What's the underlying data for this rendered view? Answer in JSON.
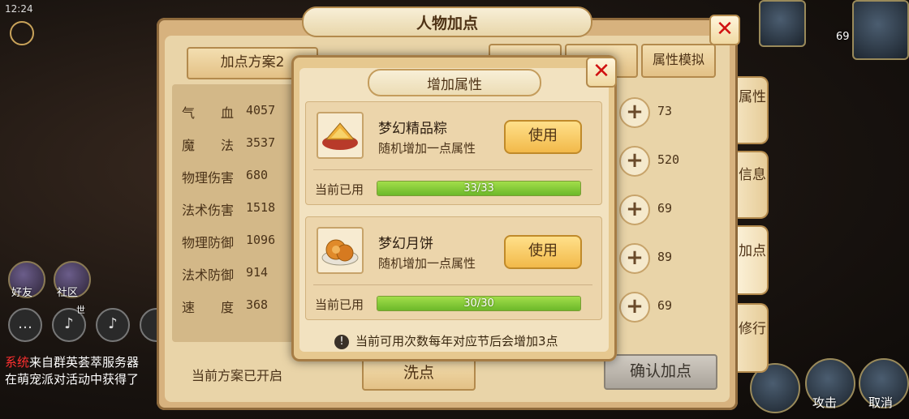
{
  "status_bar": {
    "time": "12:24"
  },
  "hud_left": {
    "friends_label": "好友",
    "community_label": "社区",
    "world_label": "世"
  },
  "chat": {
    "line1_tag": "系统",
    "line1_text": "来自群英荟萃服务器",
    "line2_text": "在萌宠派对活动中获得了"
  },
  "hud_right": {
    "top_value": "69",
    "attack_label": "攻击",
    "cancel_label": "取消"
  },
  "panel": {
    "title": "人物加点",
    "plan_button": "加点方案2",
    "stats": [
      {
        "label": "气　　血",
        "value": "4057"
      },
      {
        "label": "魔　　法",
        "value": "3537"
      },
      {
        "label": "物理伤害",
        "value": "680"
      },
      {
        "label": "法术伤害",
        "value": "1518"
      },
      {
        "label": "物理防御",
        "value": "1096"
      },
      {
        "label": "法术防御",
        "value": "914"
      },
      {
        "label": "速　　度",
        "value": "368"
      }
    ],
    "plan_status": "当前方案已开启",
    "top_buttons": [
      "属性模拟"
    ],
    "point_values": [
      "73",
      "520",
      "69",
      "89",
      "69"
    ],
    "wash_button": "洗点",
    "confirm_button": "确认加点",
    "side_tabs": [
      "属性",
      "信息",
      "加点",
      "修行"
    ]
  },
  "dialog": {
    "title": "增加属性",
    "items": [
      {
        "name": "梦幻精品粽",
        "desc": "随机增加一点属性",
        "use_label": "使用",
        "used_label": "当前已用",
        "progress_text": "33/33",
        "progress_fraction": 1.0
      },
      {
        "name": "梦幻月饼",
        "desc": "随机增加一点属性",
        "use_label": "使用",
        "used_label": "当前已用",
        "progress_text": "30/30",
        "progress_fraction": 1.0
      }
    ],
    "notice": "当前可用次数每年对应节后会增加3点"
  },
  "colors": {
    "close_x": "#d01010",
    "progress_green": "#8ccf3a",
    "use_button": "#f2b94a"
  }
}
